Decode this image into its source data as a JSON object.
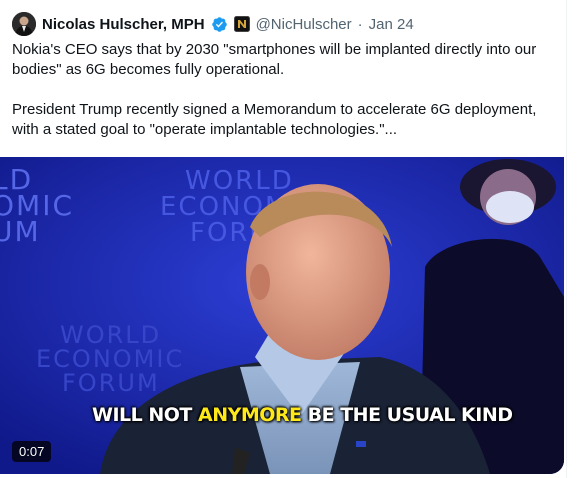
{
  "tweet": {
    "author_name": "Nicolas Hulscher, MPH",
    "handle": "@NicHulscher",
    "separator": "·",
    "date": "Jan 24",
    "paragraph1": "Nokia's CEO says that by 2030 \"smartphones will be implanted directly into our bodies\" as 6G becomes fully operational.",
    "paragraph2": "President Trump recently signed a Memorandum to accelerate 6G deployment, with a stated goal to \"operate implantable technologies.\"..."
  },
  "video": {
    "caption_pre": "WILL NOT ",
    "caption_highlight": "ANYMORE",
    "caption_post": " BE THE USUAL KIND",
    "duration": "0:07",
    "backdrop_text_left": "LD\nOMIC\nUM",
    "backdrop_text_center": "WORLD\nECONOMIC\nFORUM",
    "backdrop_text_lower": "WORLD\nECONOMIC\nFORUM"
  },
  "colors": {
    "verified_blue": "#1d9bf0",
    "caption_highlight": "#ffe81a",
    "stage_blue": "#1b2bb5"
  },
  "icons": [
    "avatar",
    "verified-badge-icon",
    "affiliate-badge-icon"
  ]
}
